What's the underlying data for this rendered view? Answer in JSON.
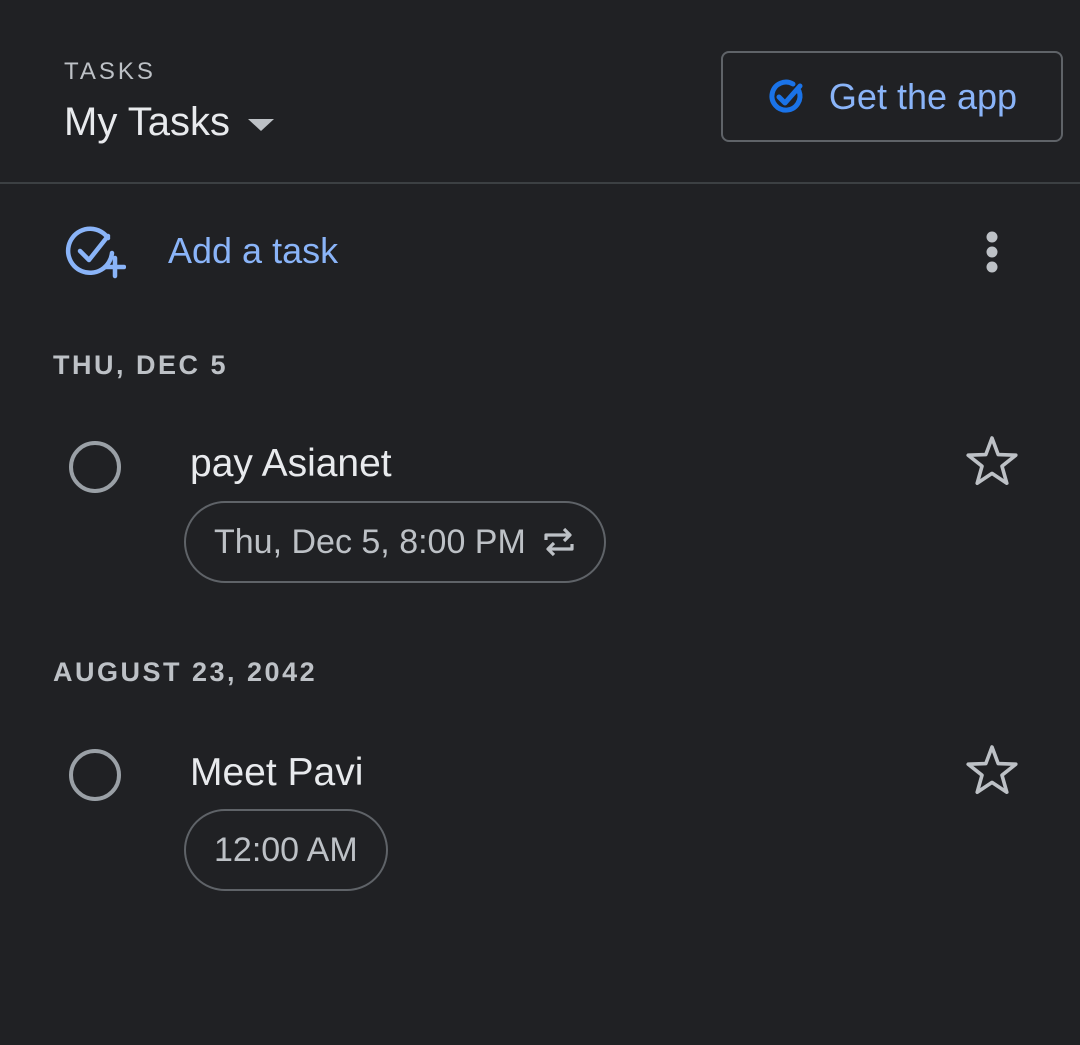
{
  "header": {
    "caption": "TASKS",
    "list_title": "My Tasks",
    "get_app_label": "Get the app"
  },
  "add_task": {
    "label": "Add a task"
  },
  "groups": [
    {
      "date_label": "THU, DEC 5",
      "tasks": [
        {
          "title": "pay Asianet",
          "due": "Thu, Dec 5, 8:00 PM",
          "repeats": true,
          "starred": false
        }
      ]
    },
    {
      "date_label": "AUGUST 23, 2042",
      "tasks": [
        {
          "title": "Meet Pavi",
          "due": "12:00 AM",
          "repeats": false,
          "starred": false
        }
      ]
    }
  ],
  "colors": {
    "background": "#202124",
    "accent": "#8ab4f8",
    "app_icon": "#1a73e8",
    "primary_text": "#e8eaed",
    "secondary_text": "#bdc1c6",
    "outline": "#5f6368"
  },
  "icons": {
    "dropdown": "arrow-drop-down-icon",
    "app": "tasks-app-icon",
    "add_task": "add-task-icon",
    "more": "more-vert-icon",
    "checkbox": "circle-outline-icon",
    "repeat": "repeat-icon",
    "star": "star-outline-icon"
  }
}
